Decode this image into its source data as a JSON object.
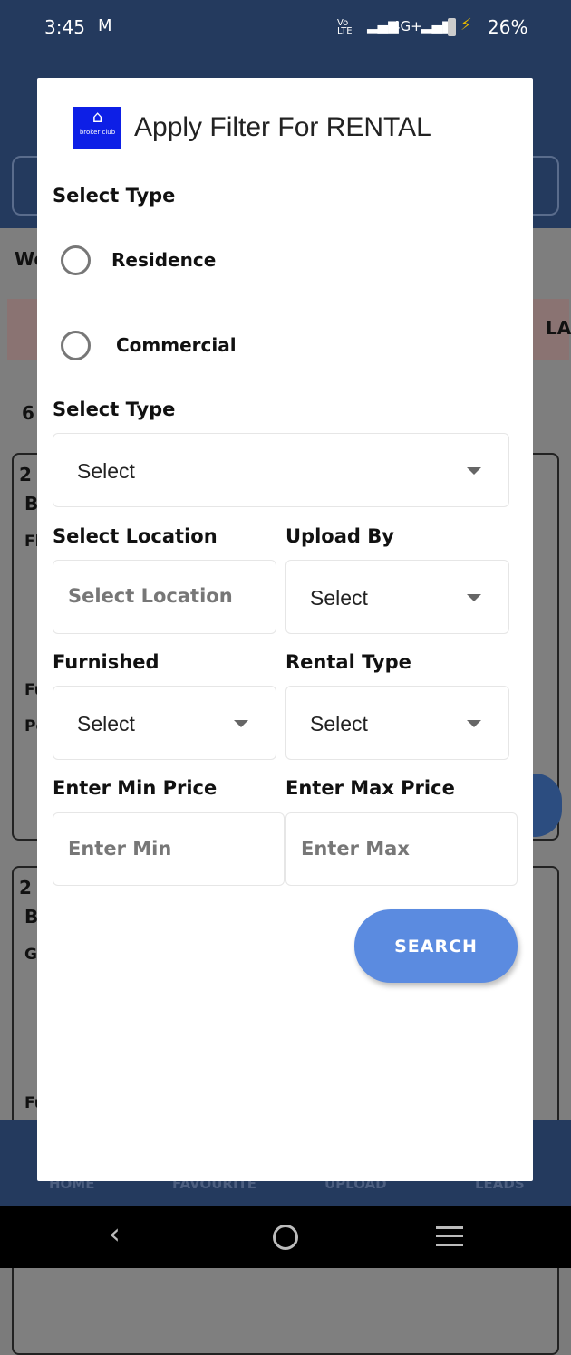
{
  "status_bar": {
    "time": "3:45",
    "network": "4G+",
    "battery": "26%",
    "colors": {
      "background": "#243a5e"
    }
  },
  "background": {
    "partial_texts": [
      "We",
      "LA",
      "6",
      "2",
      "B",
      "Fl",
      "Fu",
      "Pe",
      "2",
      "B",
      "G",
      "Fu"
    ],
    "bottom_nav": [
      "HOME",
      "FAVOURITE",
      "UPLOAD",
      "LEADS"
    ]
  },
  "dialog": {
    "logo_text": "broker club",
    "title": "Apply Filter For RENTAL",
    "type_label": "Select Type",
    "radio_options": [
      {
        "label": "Residence",
        "selected": false
      },
      {
        "label": "Commercial",
        "selected": false
      }
    ],
    "subtype_label": "Select Type",
    "subtype_value": "Select",
    "location_label": "Select Location",
    "location_placeholder": "Select Location",
    "upload_by_label": "Upload By",
    "upload_by_value": "Select",
    "furnished_label": "Furnished",
    "furnished_value": "Select",
    "rental_type_label": "Rental Type",
    "rental_type_value": "Select",
    "min_price_label": "Enter Min Price",
    "min_price_placeholder": "Enter Min",
    "max_price_label": "Enter Max Price",
    "max_price_placeholder": "Enter Max",
    "search_button": "SEARCH",
    "colors": {
      "accent": "#5b8be0",
      "logo": "#0d1fe6"
    }
  }
}
